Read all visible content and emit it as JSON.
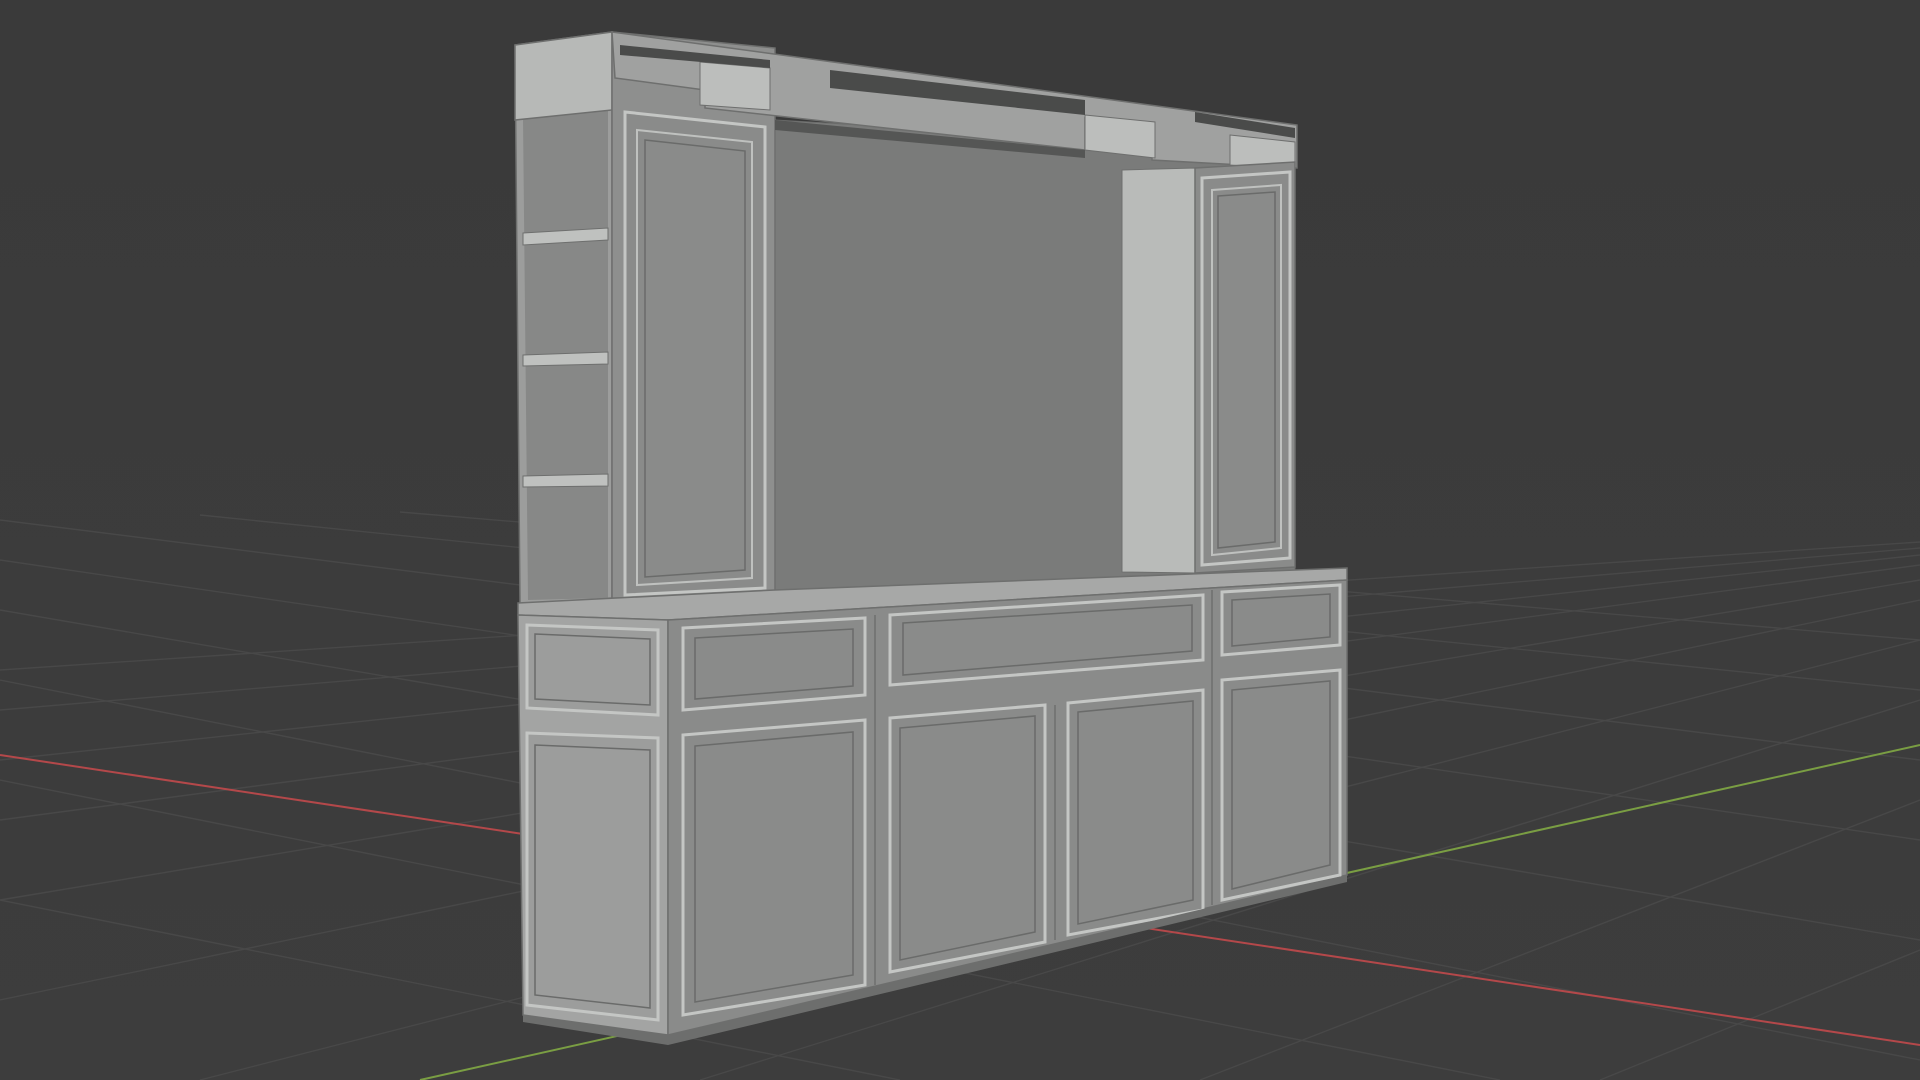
{
  "viewport": {
    "background": "#3c3c3c",
    "grid_color": "#4a4a4a",
    "x_axis_color": "#c24a4a",
    "y_axis_color": "#7fa845",
    "mesh_light": "#b8bab8",
    "mesh_mid": "#9a9c9a",
    "mesh_dark": "#7c7d7c",
    "mesh_shadow": "#5a5b5a"
  }
}
